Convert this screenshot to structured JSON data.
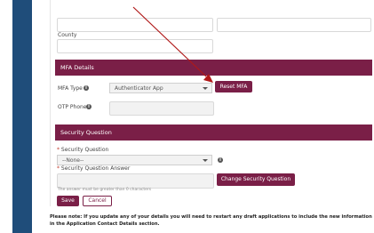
{
  "address": {
    "county_label": "County",
    "county_value": ""
  },
  "mfa": {
    "section_title": "MFA Details",
    "type_label": "MFA Type",
    "type_value": "Authenticator App",
    "reset_button": "Reset MFA",
    "otp_label": "OTP Phone",
    "otp_value": ""
  },
  "security": {
    "section_title": "Security Question",
    "question_label": "Security Question",
    "question_value": "--None--",
    "answer_label": "Security Question Answer",
    "answer_value": "",
    "answer_hint": "The answer must be greater than 0 characters",
    "change_button": "Change Security Question"
  },
  "actions": {
    "save_label": "Save",
    "cancel_label": "Cancel"
  },
  "notice": {
    "line1": "Please note: If you update any of your details you will need to restart any draft applications to include the new information",
    "line2": "in the Application Contact Details section."
  },
  "colors": {
    "brand_maroon": "#7a1f47",
    "stripe_blue": "#1f4d7a",
    "annotation_red": "#b01818"
  }
}
